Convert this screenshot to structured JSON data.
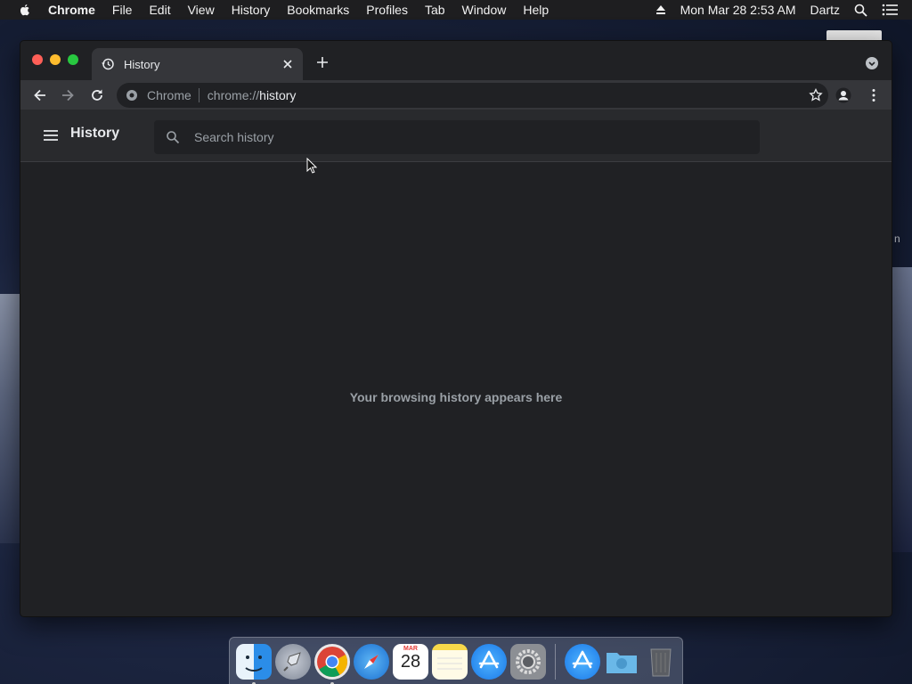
{
  "menubar": {
    "app_name": "Chrome",
    "items": [
      "File",
      "Edit",
      "View",
      "History",
      "Bookmarks",
      "Profiles",
      "Tab",
      "Window",
      "Help"
    ],
    "clock": "Mon Mar 28  2:53 AM",
    "user": "Dartz"
  },
  "desktop": {
    "partial_label": "n"
  },
  "browser": {
    "tab": {
      "title": "History",
      "icon": "history-icon"
    },
    "omnibox": {
      "chip": "Chrome",
      "url_scheme": "chrome://",
      "url_host": "history"
    }
  },
  "history_page": {
    "title": "History",
    "search_placeholder": "Search history",
    "search_value": "",
    "empty_message": "Your browsing history appears here"
  },
  "dock": {
    "items": [
      "Finder",
      "Launchpad",
      "Google Chrome",
      "Safari",
      "Calendar",
      "Notes",
      "App Store",
      "System Preferences",
      "Applications",
      "Downloads",
      "Trash"
    ],
    "calendar": {
      "month": "MAR",
      "day": "28"
    }
  },
  "colors": {
    "page_bg": "#202124",
    "toolbar_bg": "#35363a",
    "header_bg": "#292a2d",
    "text_primary": "#e8eaed",
    "text_secondary": "#9aa0a6"
  }
}
